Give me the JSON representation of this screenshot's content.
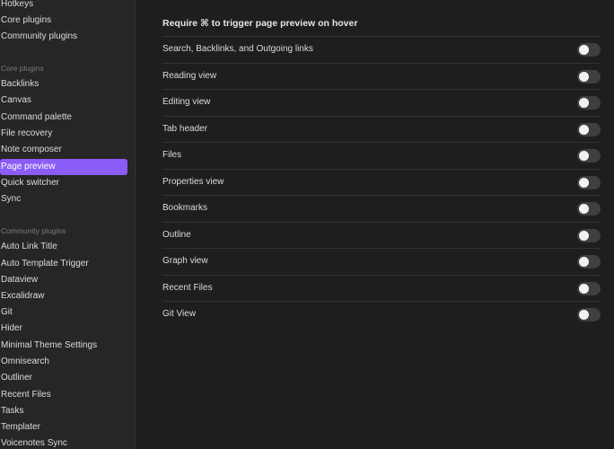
{
  "sidebar": {
    "top_items": [
      {
        "label": "Hotkeys"
      },
      {
        "label": "Core plugins"
      },
      {
        "label": "Community plugins"
      }
    ],
    "core_heading": "Core plugins",
    "core_items": [
      {
        "label": "Backlinks"
      },
      {
        "label": "Canvas"
      },
      {
        "label": "Command palette"
      },
      {
        "label": "File recovery"
      },
      {
        "label": "Note composer"
      },
      {
        "label": "Page preview",
        "active": true
      },
      {
        "label": "Quick switcher"
      },
      {
        "label": "Sync"
      }
    ],
    "community_heading": "Community plugins",
    "community_items": [
      {
        "label": "Auto Link Title"
      },
      {
        "label": "Auto Template Trigger"
      },
      {
        "label": "Dataview"
      },
      {
        "label": "Excalidraw"
      },
      {
        "label": "Git"
      },
      {
        "label": "Hider"
      },
      {
        "label": "Minimal Theme Settings"
      },
      {
        "label": "Omnisearch"
      },
      {
        "label": "Outliner"
      },
      {
        "label": "Recent Files"
      },
      {
        "label": "Tasks"
      },
      {
        "label": "Templater"
      },
      {
        "label": "Voicenotes Sync"
      }
    ]
  },
  "main": {
    "section_title": "Require ⌘ to trigger page preview on hover",
    "settings": [
      {
        "label": "Search, Backlinks, and Outgoing links",
        "enabled": false
      },
      {
        "label": "Reading view",
        "enabled": false
      },
      {
        "label": "Editing view",
        "enabled": false
      },
      {
        "label": "Tab header",
        "enabled": false
      },
      {
        "label": "Files",
        "enabled": false
      },
      {
        "label": "Properties view",
        "enabled": false
      },
      {
        "label": "Bookmarks",
        "enabled": false
      },
      {
        "label": "Outline",
        "enabled": false
      },
      {
        "label": "Graph view",
        "enabled": false
      },
      {
        "label": "Recent Files",
        "enabled": false
      },
      {
        "label": "Git View",
        "enabled": false
      }
    ]
  },
  "colors": {
    "accent": "#8b5cf6",
    "sidebar_bg": "#262626",
    "main_bg": "#1e1e1e",
    "toggle_off": "#3f3f3f"
  }
}
